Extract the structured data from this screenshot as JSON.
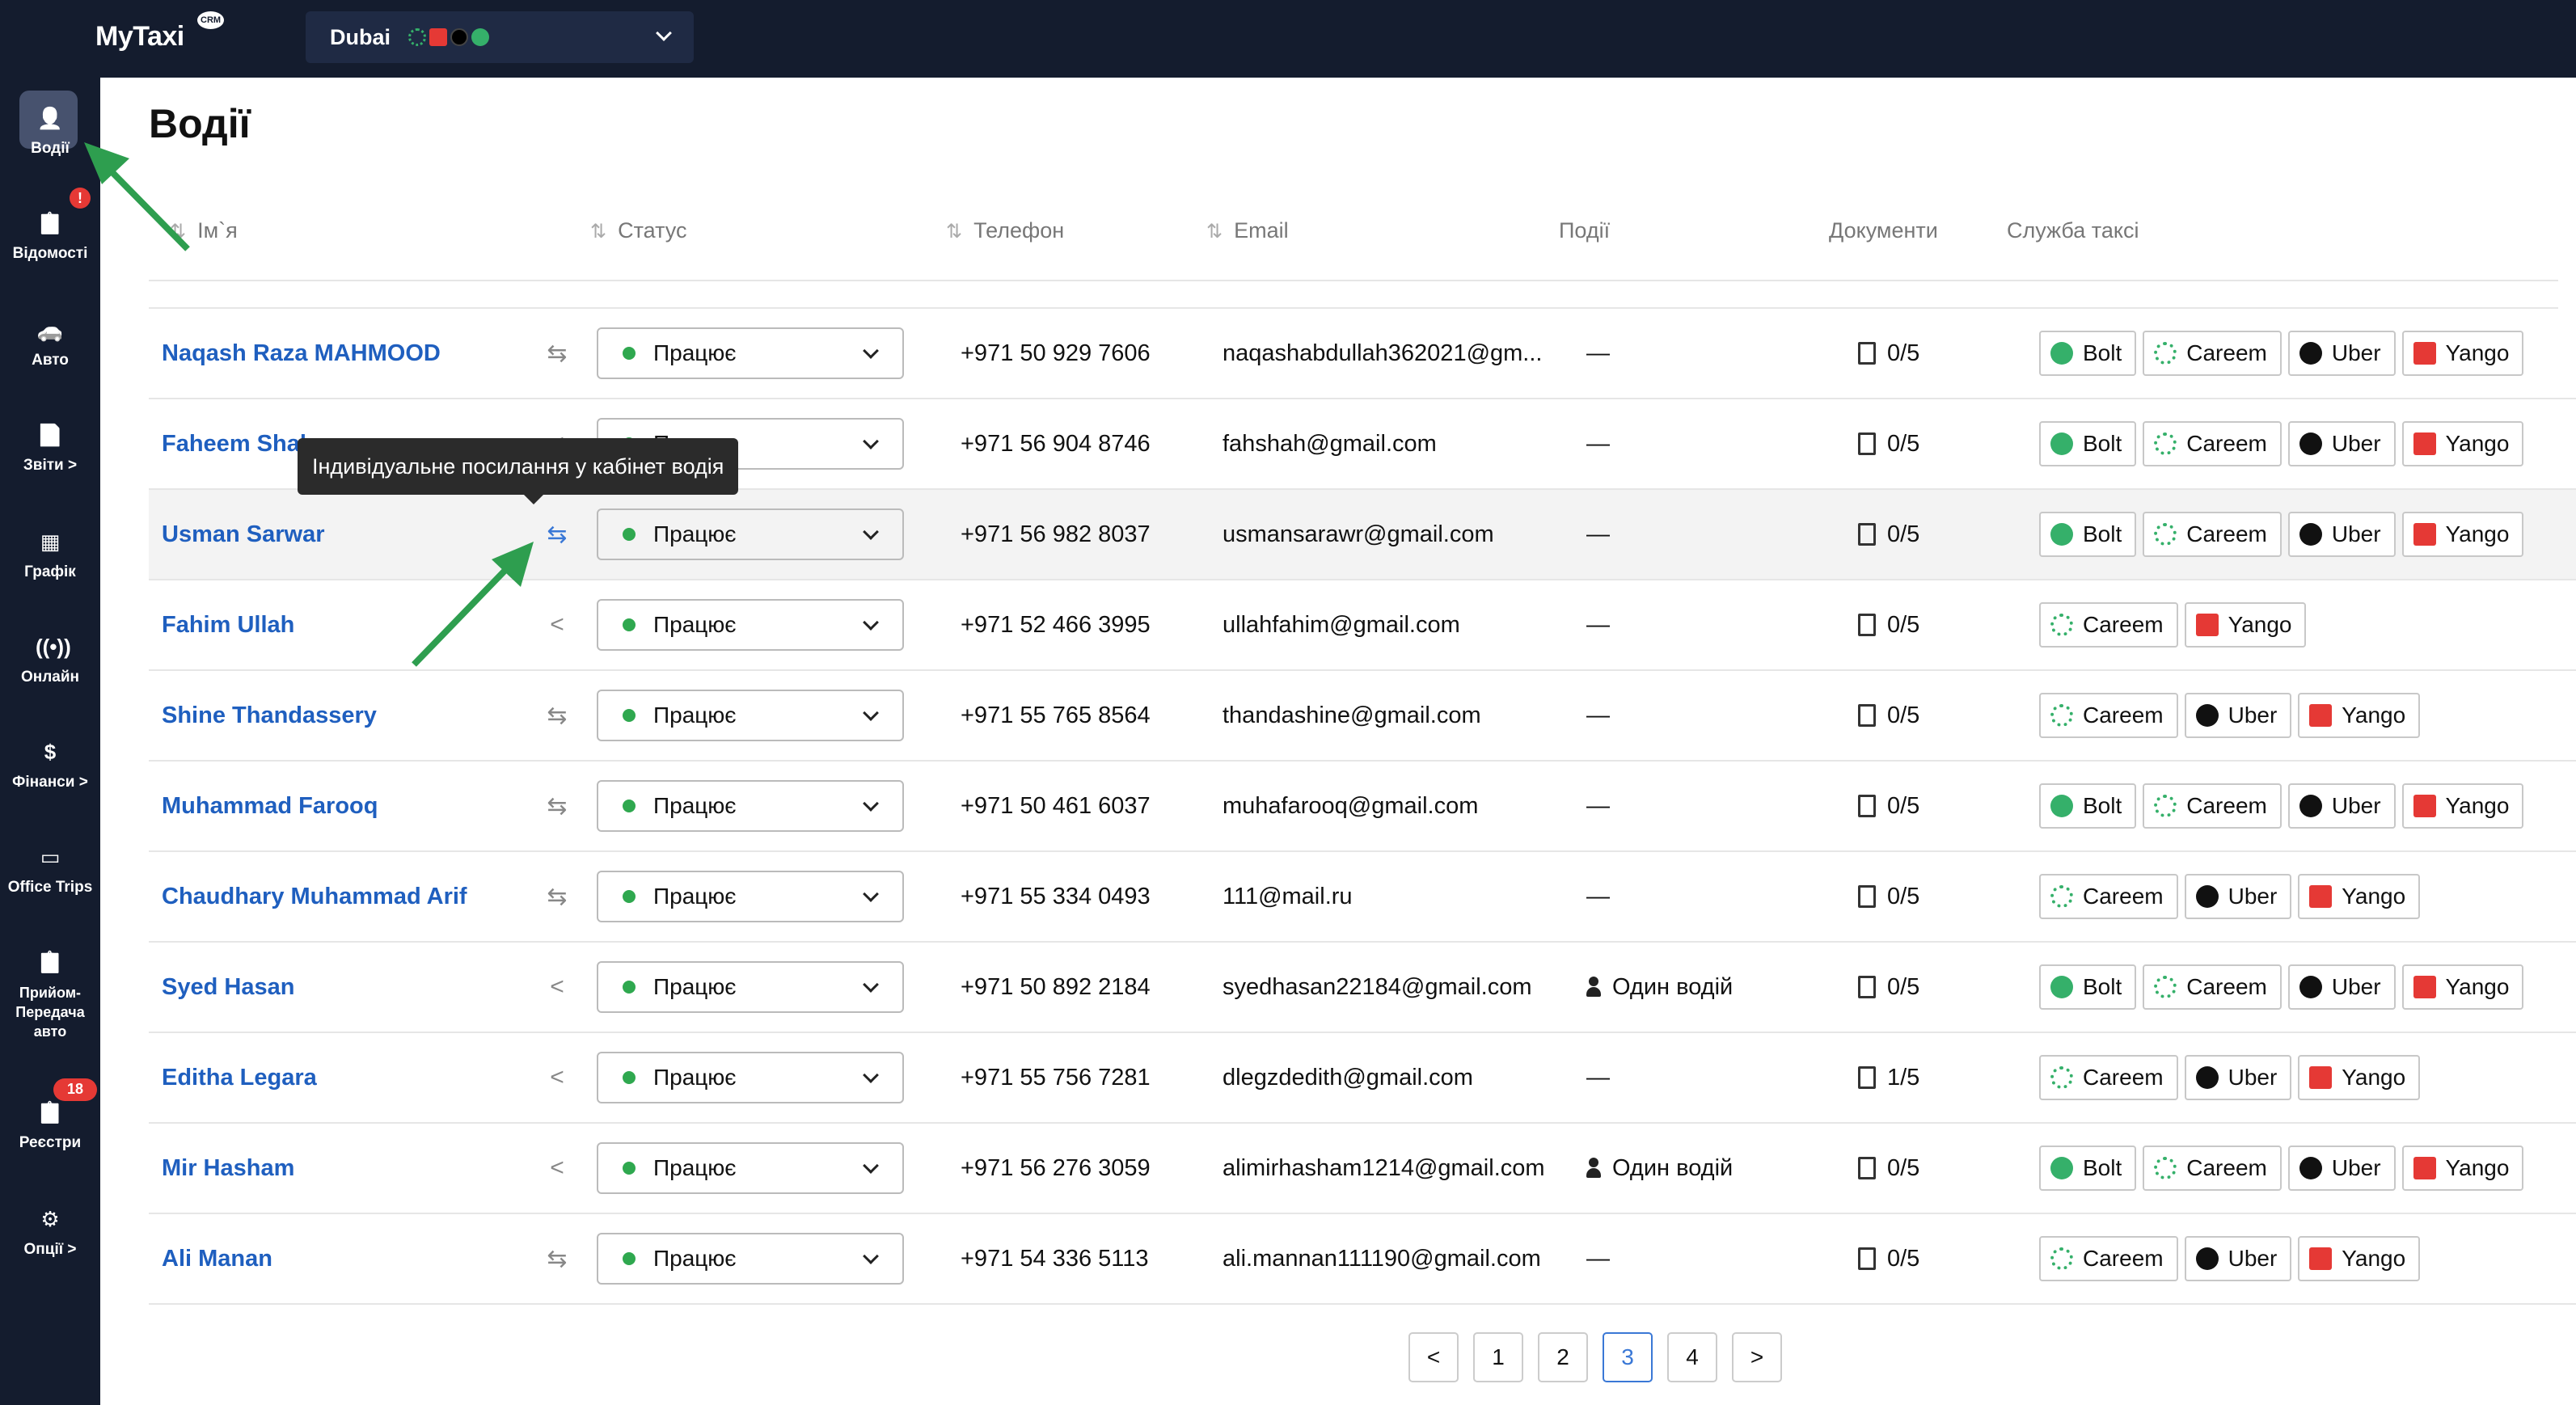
{
  "app": {
    "logo": "MyTaxi",
    "logo_badge": "CRM"
  },
  "city_selector": {
    "value": "Dubai",
    "icons": [
      "careem-icon",
      "yango-icon",
      "uber-icon",
      "bolt-icon"
    ]
  },
  "sidebar": {
    "items": [
      {
        "label": "Водії",
        "icon": "user-icon",
        "active": true
      },
      {
        "label": "Відомості",
        "icon": "clipboard-icon",
        "badge": "!"
      },
      {
        "label": "Авто",
        "icon": "car-icon"
      },
      {
        "label": "Звіти >",
        "icon": "report-icon"
      },
      {
        "label": "Графік",
        "icon": "calendar-icon"
      },
      {
        "label": "Онлайн",
        "icon": "broadcast-icon"
      },
      {
        "label": "Фінанси >",
        "icon": "finance-icon"
      },
      {
        "label": "Office Trips",
        "icon": "briefcase-icon"
      },
      {
        "label": "Прийом-Передача авто",
        "icon": "handover-icon",
        "badge": "18"
      },
      {
        "label": "Реєстри",
        "icon": "registry-icon"
      },
      {
        "label": "Опції >",
        "icon": "gear-icon"
      }
    ]
  },
  "page": {
    "title": "Водії"
  },
  "table": {
    "headers": {
      "name": "Ім`я",
      "status": "Статус",
      "phone": "Телефон",
      "email": "Email",
      "events": "Події",
      "documents": "Документи",
      "service": "Служба таксі"
    },
    "rows": [
      {
        "name": "Naqash Raza MAHMOOD",
        "link": "add-link-icon",
        "status": "Працює",
        "phone": "+971 50 929 7606",
        "email": "naqashabdullah362021@gm...",
        "events": "—",
        "docs": "0/5",
        "services": [
          "Bolt",
          "Careem",
          "Uber",
          "Yango"
        ]
      },
      {
        "name": "Faheem Shah",
        "link": "share-icon",
        "status": "Працює",
        "phone": "+971 56 904 8746",
        "email": "fahshah@gmail.com",
        "events": "—",
        "docs": "0/5",
        "services": [
          "Bolt",
          "Careem",
          "Uber",
          "Yango"
        ]
      },
      {
        "name": "Usman Sarwar",
        "link": "add-link-icon",
        "status": "Працює",
        "phone": "+971 56 982 8037",
        "email": "usmansarawr@gmail.com",
        "events": "—",
        "docs": "0/5",
        "services": [
          "Bolt",
          "Careem",
          "Uber",
          "Yango"
        ],
        "highlight": true
      },
      {
        "name": "Fahim Ullah",
        "link": "share-icon",
        "status": "Працює",
        "phone": "+971 52 466 3995",
        "email": "ullahfahim@gmail.com",
        "events": "—",
        "docs": "0/5",
        "services": [
          "Careem",
          "Yango"
        ]
      },
      {
        "name": "Shine Thandassery",
        "link": "add-link-icon",
        "status": "Працює",
        "phone": "+971 55 765 8564",
        "email": "thandashine@gmail.com",
        "events": "—",
        "docs": "0/5",
        "services": [
          "Careem",
          "Uber",
          "Yango"
        ]
      },
      {
        "name": "Muhammad Farooq",
        "link": "add-link-icon",
        "status": "Працює",
        "phone": "+971 50 461 6037",
        "email": "muhafarooq@gmail.com",
        "events": "—",
        "docs": "0/5",
        "services": [
          "Bolt",
          "Careem",
          "Uber",
          "Yango"
        ]
      },
      {
        "name": "Chaudhary Muhammad Arif",
        "link": "add-link-icon",
        "status": "Працює",
        "phone": "+971 55 334 0493",
        "email": "111@mail.ru",
        "events": "—",
        "docs": "0/5",
        "services": [
          "Careem",
          "Uber",
          "Yango"
        ]
      },
      {
        "name": "Syed Hasan",
        "link": "share-icon",
        "status": "Працює",
        "phone": "+971 50 892 2184",
        "email": "syedhasan22184@gmail.com",
        "events": "Один водій",
        "events_icon": "person-icon",
        "docs": "0/5",
        "services": [
          "Bolt",
          "Careem",
          "Uber",
          "Yango"
        ]
      },
      {
        "name": "Editha Legara",
        "link": "share-icon",
        "status": "Працює",
        "phone": "+971 55 756 7281",
        "email": "dlegzdedith@gmail.com",
        "events": "—",
        "docs": "1/5",
        "services": [
          "Careem",
          "Uber",
          "Yango"
        ]
      },
      {
        "name": "Mir Hasham",
        "link": "share-icon",
        "status": "Працює",
        "phone": "+971 56 276 3059",
        "email": "alimirhasham1214@gmail.com",
        "events": "Один водій",
        "events_icon": "person-icon",
        "docs": "0/5",
        "services": [
          "Bolt",
          "Careem",
          "Uber",
          "Yango"
        ]
      },
      {
        "name": "Ali Manan",
        "link": "add-link-icon",
        "status": "Працює",
        "phone": "+971 54 336 5113",
        "email": "ali.mannan111190@gmail.com",
        "events": "—",
        "docs": "0/5",
        "services": [
          "Careem",
          "Uber",
          "Yango"
        ]
      }
    ]
  },
  "tooltip": {
    "text": "Індивідуальне посилання у кабінет водія"
  },
  "pagination": {
    "prev": "<",
    "next": ">",
    "pages": [
      "1",
      "2",
      "3",
      "4"
    ],
    "current": "3"
  },
  "colors": {
    "sidebar_bg": "#141c2e",
    "link": "#1f5fbf",
    "status_ok": "#2fa84f",
    "annotation_arrow": "#2e9e4f",
    "badge": "#e53935"
  }
}
